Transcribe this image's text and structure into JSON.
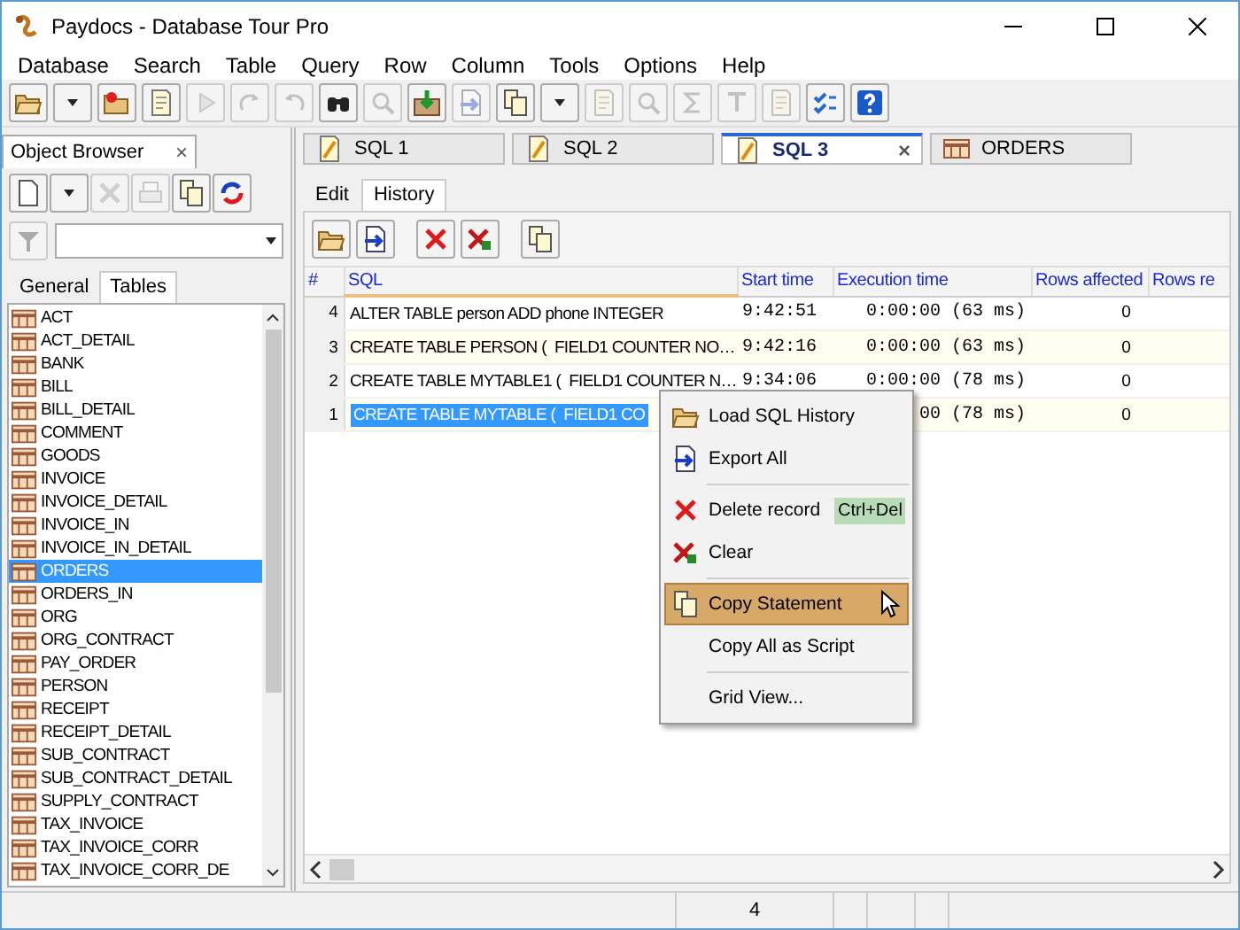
{
  "window": {
    "title": "Paydocs - Database Tour Pro"
  },
  "menu": [
    "Database",
    "Search",
    "Table",
    "Query",
    "Row",
    "Column",
    "Tools",
    "Options",
    "Help"
  ],
  "toolbar": [
    {
      "kind": "open",
      "disabled": false
    },
    {
      "kind": "dropdown",
      "disabled": false
    },
    {
      "kind": "close-folder",
      "disabled": false
    },
    {
      "kind": "script",
      "disabled": false
    },
    {
      "kind": "run",
      "disabled": true
    },
    {
      "kind": "redo",
      "disabled": true
    },
    {
      "kind": "undo",
      "disabled": true
    },
    {
      "kind": "find",
      "disabled": false
    },
    {
      "kind": "replace",
      "disabled": true
    },
    {
      "kind": "import",
      "disabled": false
    },
    {
      "kind": "export",
      "disabled": true
    },
    {
      "kind": "copy",
      "disabled": false
    },
    {
      "kind": "dropdown",
      "disabled": false
    },
    {
      "kind": "page",
      "disabled": true
    },
    {
      "kind": "zoom",
      "disabled": true
    },
    {
      "kind": "sigma",
      "disabled": true
    },
    {
      "kind": "text",
      "disabled": true
    },
    {
      "kind": "note",
      "disabled": true
    },
    {
      "kind": "check",
      "disabled": false
    },
    {
      "kind": "help",
      "disabled": false
    }
  ],
  "browser": {
    "title": "Object Browser",
    "close": "×",
    "toolbar": [
      {
        "kind": "new",
        "disabled": false
      },
      {
        "kind": "dropdown",
        "disabled": false
      },
      {
        "kind": "delete",
        "disabled": true
      },
      {
        "kind": "print",
        "disabled": true
      },
      {
        "kind": "copy",
        "disabled": false
      },
      {
        "kind": "refresh",
        "disabled": false
      }
    ],
    "tabs": [
      {
        "label": "General",
        "selected": false
      },
      {
        "label": "Tables",
        "selected": true
      }
    ],
    "items": [
      {
        "label": "ACT",
        "selected": false
      },
      {
        "label": "ACT_DETAIL",
        "selected": false
      },
      {
        "label": "BANK",
        "selected": false
      },
      {
        "label": "BILL",
        "selected": false
      },
      {
        "label": "BILL_DETAIL",
        "selected": false
      },
      {
        "label": "COMMENT",
        "selected": false
      },
      {
        "label": "GOODS",
        "selected": false
      },
      {
        "label": "INVOICE",
        "selected": false
      },
      {
        "label": "INVOICE_DETAIL",
        "selected": false
      },
      {
        "label": "INVOICE_IN",
        "selected": false
      },
      {
        "label": "INVOICE_IN_DETAIL",
        "selected": false
      },
      {
        "label": "ORDERS",
        "selected": true
      },
      {
        "label": "ORDERS_IN",
        "selected": false
      },
      {
        "label": "ORG",
        "selected": false
      },
      {
        "label": "ORG_CONTRACT",
        "selected": false
      },
      {
        "label": "PAY_ORDER",
        "selected": false
      },
      {
        "label": "PERSON",
        "selected": false
      },
      {
        "label": "RECEIPT",
        "selected": false
      },
      {
        "label": "RECEIPT_DETAIL",
        "selected": false
      },
      {
        "label": "SUB_CONTRACT",
        "selected": false
      },
      {
        "label": "SUB_CONTRACT_DETAIL",
        "selected": false
      },
      {
        "label": "SUPPLY_CONTRACT",
        "selected": false
      },
      {
        "label": "TAX_INVOICE",
        "selected": false
      },
      {
        "label": "TAX_INVOICE_CORR",
        "selected": false
      },
      {
        "label": "TAX_INVOICE_CORR_DE",
        "selected": false
      }
    ]
  },
  "doc_tabs": [
    {
      "label": "SQL 1",
      "kind": "sql",
      "selected": false
    },
    {
      "label": "SQL 2",
      "kind": "sql",
      "selected": false
    },
    {
      "label": "SQL 3",
      "kind": "sql",
      "selected": true,
      "close": "×"
    },
    {
      "label": "ORDERS",
      "kind": "table",
      "selected": false
    }
  ],
  "sub_tabs": [
    {
      "label": "Edit",
      "selected": false
    },
    {
      "label": "History",
      "selected": true
    }
  ],
  "history_toolbar": [
    {
      "kind": "folder",
      "disabled": false
    },
    {
      "kind": "export",
      "disabled": false
    },
    {
      "kind": "delete",
      "disabled": false
    },
    {
      "kind": "clear",
      "disabled": false
    },
    {
      "kind": "copy",
      "disabled": false
    }
  ],
  "grid": {
    "columns": [
      "#",
      "SQL",
      "Start time",
      "Execution time",
      "Rows affected",
      "Rows re"
    ],
    "rows": [
      {
        "num": "4",
        "sql": "ALTER TABLE person ADD phone INTEGER",
        "start": "9:42:51",
        "exec": "0:00:00",
        "ms": "(63 ms)",
        "rows": "0",
        "selected": false
      },
      {
        "num": "3",
        "sql": "CREATE TABLE PERSON (  FIELD1 COUNTER NO…",
        "start": "9:42:16",
        "exec": "0:00:00",
        "ms": "(63 ms)",
        "rows": "0",
        "selected": false
      },
      {
        "num": "2",
        "sql": "CREATE TABLE MYTABLE1 (  FIELD1 COUNTER N…",
        "start": "9:34:06",
        "exec": "0:00:00",
        "ms": "(78 ms)",
        "rows": "0",
        "selected": false
      },
      {
        "num": "1",
        "sql": "CREATE TABLE MYTABLE (  FIELD1 CO",
        "exec": "00",
        "ms": "(78 ms)",
        "rows": "0",
        "selected": true
      }
    ]
  },
  "context_menu": [
    {
      "label": "Load SQL History",
      "kind": "folder",
      "selected": false,
      "separator_before": false
    },
    {
      "label": "Export All",
      "kind": "export",
      "selected": false,
      "separator_before": false
    },
    {
      "label": "Delete record",
      "kind": "delete",
      "shortcut": "Ctrl+Del",
      "selected": false,
      "separator_before": true
    },
    {
      "label": "Clear",
      "kind": "clear",
      "selected": false,
      "separator_before": false
    },
    {
      "label": "Copy Statement",
      "kind": "copy",
      "selected": true,
      "separator_before": true
    },
    {
      "label": "Copy All as Script",
      "kind": "none",
      "selected": false,
      "separator_before": false
    },
    {
      "label": "Grid View...",
      "kind": "none",
      "selected": false,
      "separator_before": true
    }
  ],
  "status_bar": {
    "count": "4"
  }
}
